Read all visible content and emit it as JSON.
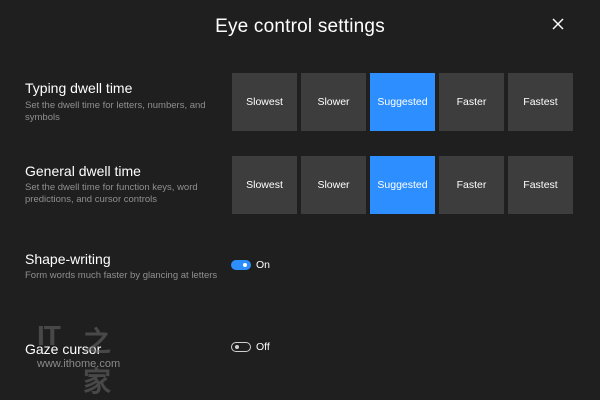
{
  "window": {
    "title": "Eye control settings"
  },
  "typing_dwell": {
    "title": "Typing dwell time",
    "description": "Set the dwell time for letters, numbers, and symbols",
    "options": [
      "Slowest",
      "Slower",
      "Suggested",
      "Faster",
      "Fastest"
    ],
    "selected": "Suggested"
  },
  "general_dwell": {
    "title": "General dwell time",
    "description": "Set the dwell time for function keys, word predictions, and cursor controls",
    "options": [
      "Slowest",
      "Slower",
      "Suggested",
      "Faster",
      "Fastest"
    ],
    "selected": "Suggested"
  },
  "shape_writing": {
    "title": "Shape-writing",
    "description": "Form words much faster by glancing at letters",
    "state": "On"
  },
  "gaze_cursor": {
    "title": "Gaze cursor",
    "state": "Off"
  },
  "watermark": {
    "brand": "IT",
    "glyph": "之家",
    "url": "www.ithome.com"
  },
  "colors": {
    "background": "#1f1f1f",
    "button": "#3d3d3d",
    "accent": "#2d8fff",
    "description_text": "#8f8f8f"
  },
  "icons": {
    "close": "close-icon"
  }
}
